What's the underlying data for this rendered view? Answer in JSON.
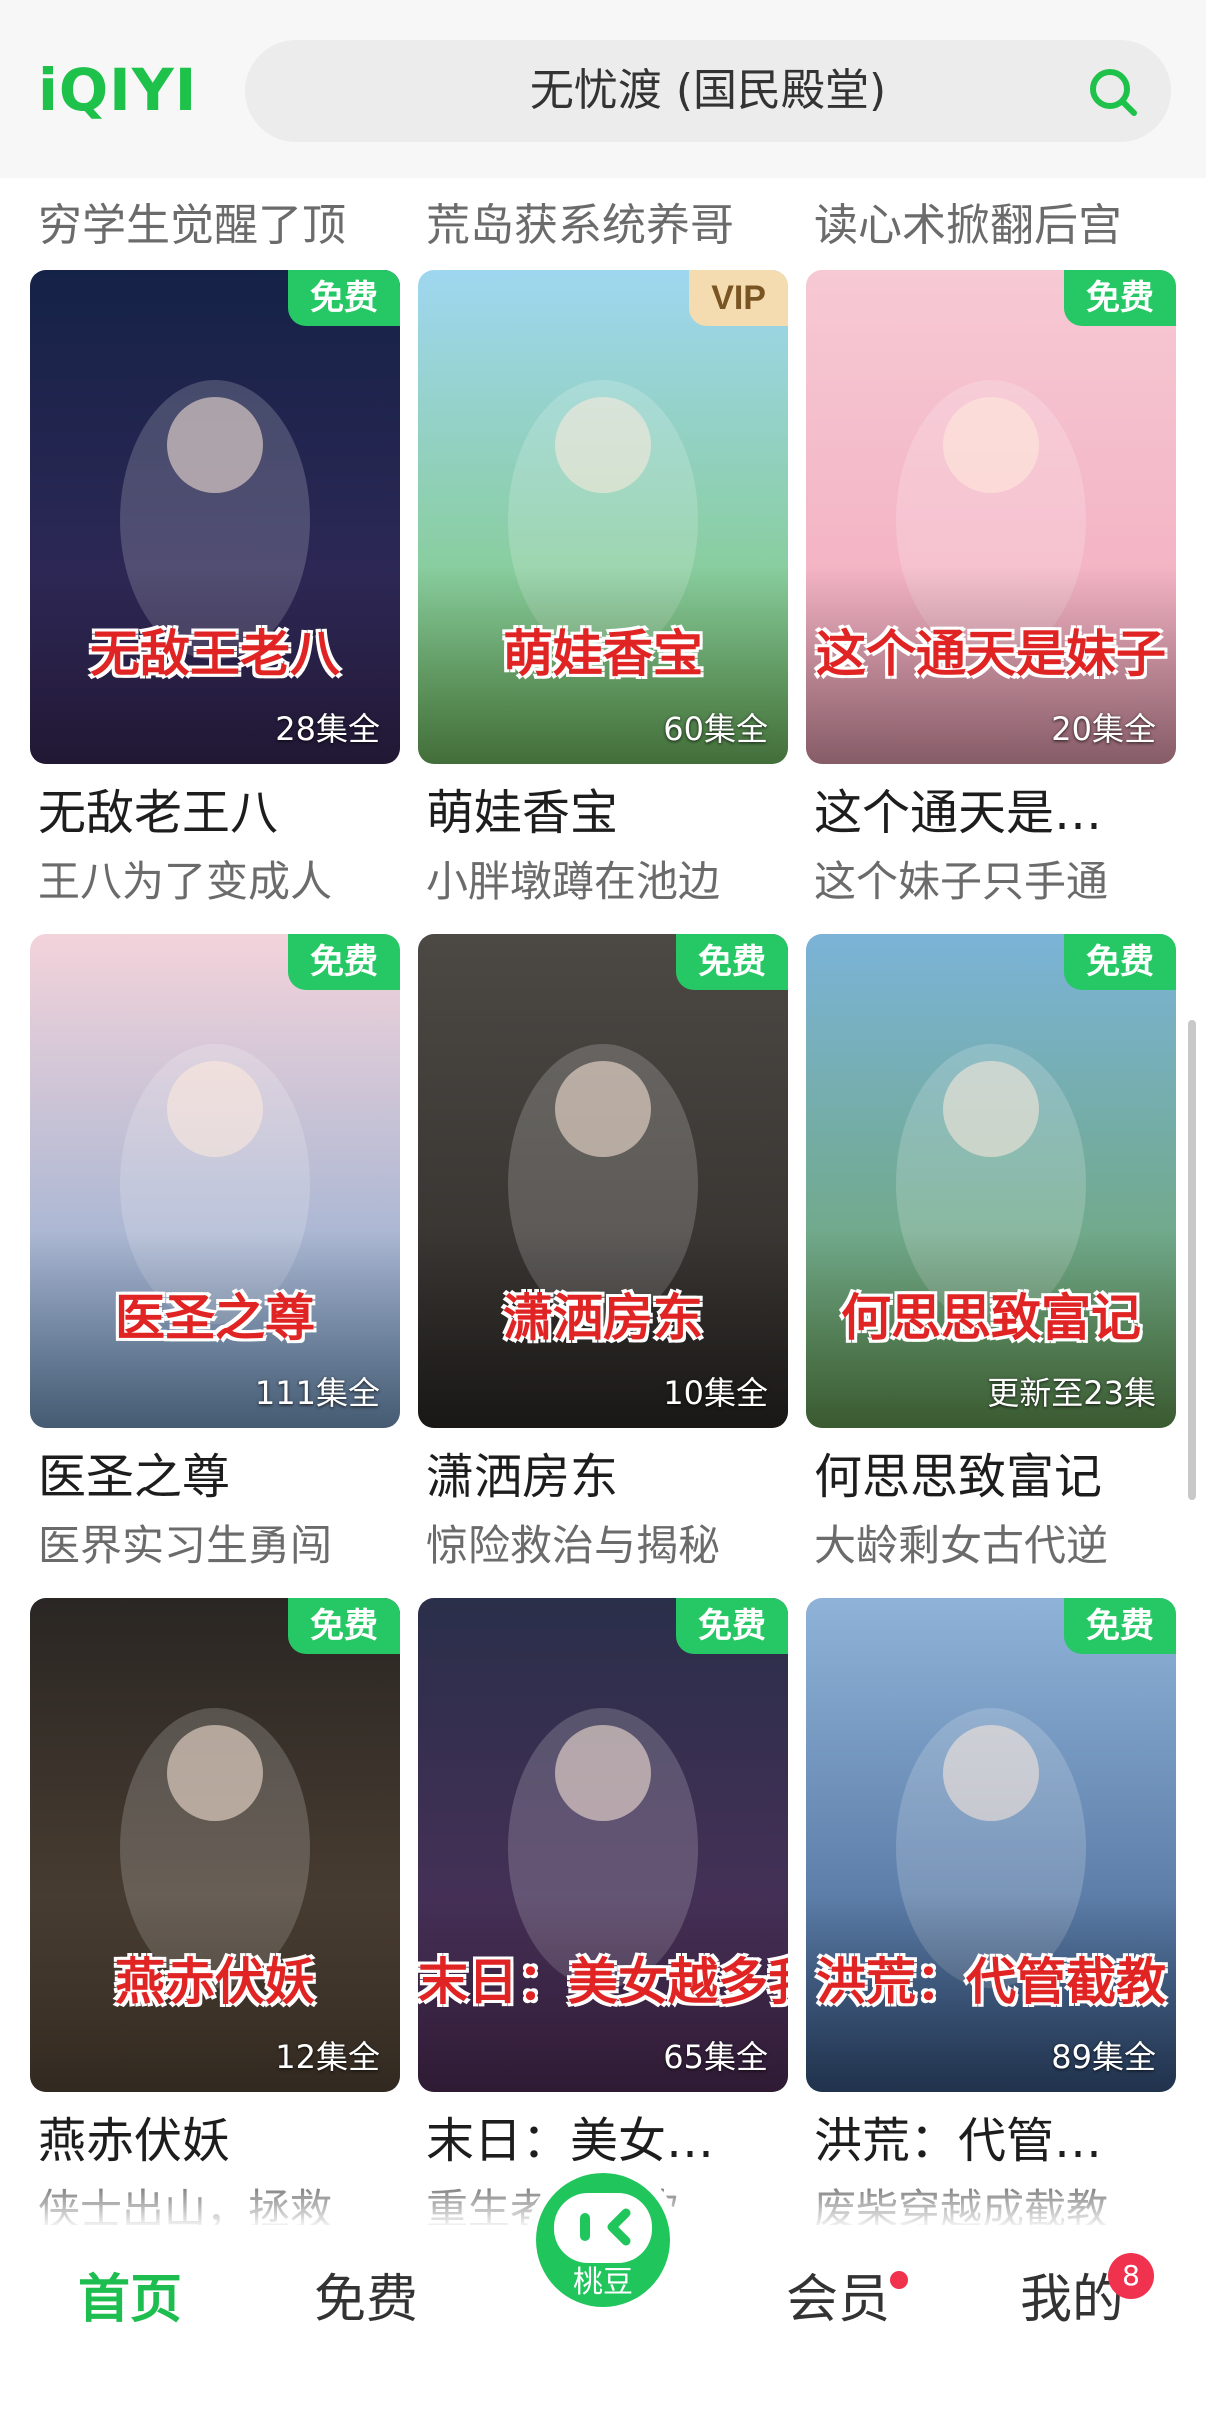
{
  "app": {
    "logo": "iQIYI",
    "brand_color": "#1ec24a"
  },
  "search": {
    "query": "无忧渡 (国民殿堂)"
  },
  "previous_row_subtitles": [
    "穷学生觉醒了顶",
    "荒岛获系统养哥",
    "读心术掀翻后宫"
  ],
  "cards": [
    {
      "title": "无敌老王八",
      "subtitle": "王八为了变成人",
      "badge": "免费",
      "badge_type": "free",
      "episodes": "28集全",
      "poster_text": "无敌王老八",
      "poster_bg": [
        "#152247",
        "#3b2b5e"
      ]
    },
    {
      "title": "萌娃香宝",
      "subtitle": "小胖墩蹲在池边",
      "badge": "VIP",
      "badge_type": "vip",
      "episodes": "60集全",
      "poster_text": "萌娃香宝",
      "poster_bg": [
        "#9fd6f0",
        "#7ac86a"
      ]
    },
    {
      "title": "这个通天是…",
      "subtitle": "这个妹子只手通",
      "badge": "免费",
      "badge_type": "free",
      "episodes": "20集全",
      "poster_text": "这个通天是妹子",
      "poster_bg": [
        "#f6c9d4",
        "#f2a7bb"
      ]
    },
    {
      "title": "医圣之尊",
      "subtitle": "医界实习生勇闯",
      "badge": "免费",
      "badge_type": "free",
      "episodes": "111集全",
      "poster_text": "医圣之尊",
      "poster_bg": [
        "#f3d3da",
        "#7ea6cf"
      ]
    },
    {
      "title": "潇洒房东",
      "subtitle": "惊险救治与揭秘",
      "badge": "免费",
      "badge_type": "free",
      "episodes": "10集全",
      "poster_text": "潇洒房东",
      "poster_bg": [
        "#4c4844",
        "#2e2b28"
      ]
    },
    {
      "title": "何思思致富记",
      "subtitle": "大龄剩女古代逆",
      "badge": "免费",
      "badge_type": "free",
      "episodes": "更新至23集",
      "poster_text": "何思思致富记",
      "poster_bg": [
        "#7bb3d8",
        "#6aa35a"
      ]
    },
    {
      "title": "燕赤伏妖",
      "subtitle": "侠士出山，拯救",
      "badge": "免费",
      "badge_type": "free",
      "episodes": "12集全",
      "poster_text": "燕赤伏妖",
      "poster_bg": [
        "#2a2623",
        "#5a4a3a"
      ]
    },
    {
      "title": "末日：美女…",
      "subtitle": "重生者…所欲",
      "badge": "免费",
      "badge_type": "free",
      "episodes": "65集全",
      "poster_text": "末日：美女越多我越强",
      "poster_bg": [
        "#2a2f4a",
        "#55305e"
      ]
    },
    {
      "title": "洪荒：代管…",
      "subtitle": "废柴穿越成截教",
      "badge": "免费",
      "badge_type": "free",
      "episodes": "89集全",
      "poster_text": "洪荒：代管截教",
      "poster_bg": [
        "#8fb3d8",
        "#3b5b8a"
      ]
    }
  ],
  "nav": {
    "home": "首页",
    "free": "免费",
    "center": "桃豆",
    "member": "会员",
    "me": "我的",
    "me_badge": "8",
    "active_color": "#1ebd50"
  }
}
